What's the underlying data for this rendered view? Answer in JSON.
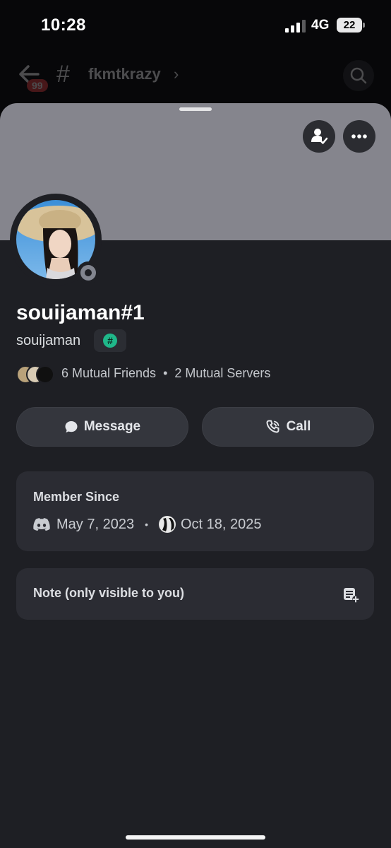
{
  "status_bar": {
    "time": "10:28",
    "network": "4G",
    "battery": "22"
  },
  "channel_header": {
    "unread_count": "99",
    "channel_name": "fkmtkrazy",
    "hash_icon": "#",
    "chevron_icon": "›"
  },
  "profile": {
    "display_name": "souijaman#1",
    "username": "souijaman",
    "tag_badge_icon": "#",
    "status": "offline",
    "mutual_friends": "6 Mutual Friends",
    "mutual_separator": "•",
    "mutual_servers": "2 Mutual Servers"
  },
  "actions": {
    "message_label": "Message",
    "call_label": "Call"
  },
  "member_since": {
    "title": "Member Since",
    "discord_date": "May 7, 2023",
    "separator": "•",
    "server_date": "Oct 18, 2025"
  },
  "note": {
    "label": "Note (only visible to you)"
  },
  "colors": {
    "banner": "#85858d",
    "sheet": "#1e1f24",
    "card": "#2b2c33",
    "badge_green": "#1fb88a",
    "unread_red": "#ed4245"
  }
}
